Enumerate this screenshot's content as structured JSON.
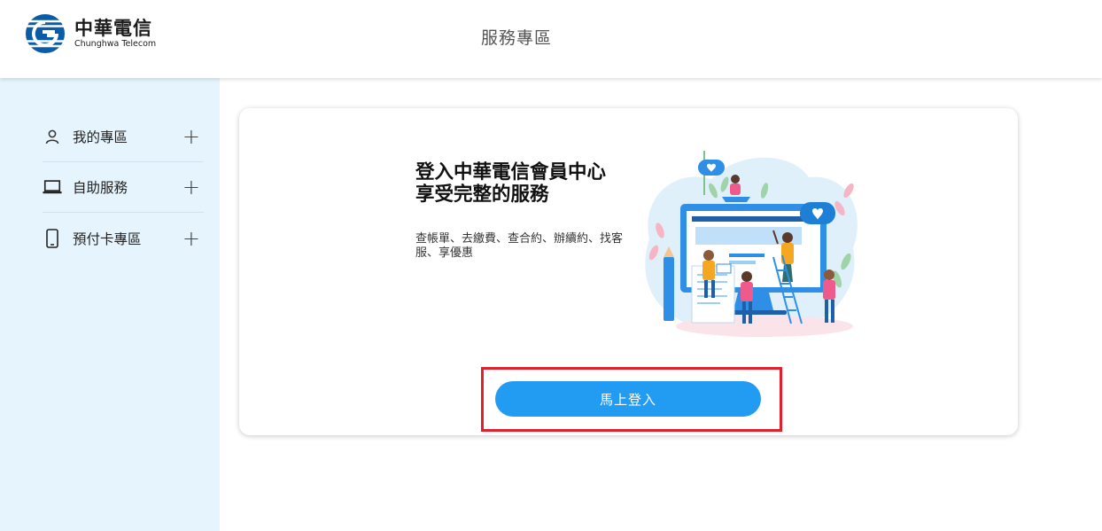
{
  "header": {
    "logo_zh": "中華電信",
    "logo_en": "Chunghwa Telecom",
    "title": "服務專區"
  },
  "sidebar": {
    "items": [
      {
        "label": "我的專區",
        "icon": "user-icon"
      },
      {
        "label": "自助服務",
        "icon": "laptop-icon"
      },
      {
        "label": "預付卡專區",
        "icon": "mobile-phone-icon"
      }
    ],
    "expand_icon": "plus-icon"
  },
  "card": {
    "title_line1": "登入中華電信會員中心",
    "title_line2": "享受完整的服務",
    "description": "查帳單、去繳費、查合約、辦續約、找客服、享優惠",
    "login_button": "馬上登入"
  },
  "colors": {
    "brand_blue": "#0a5ba8",
    "button_blue": "#229cf2",
    "sidebar_bg": "#e6f4fd",
    "highlight_red": "#e0202a"
  }
}
